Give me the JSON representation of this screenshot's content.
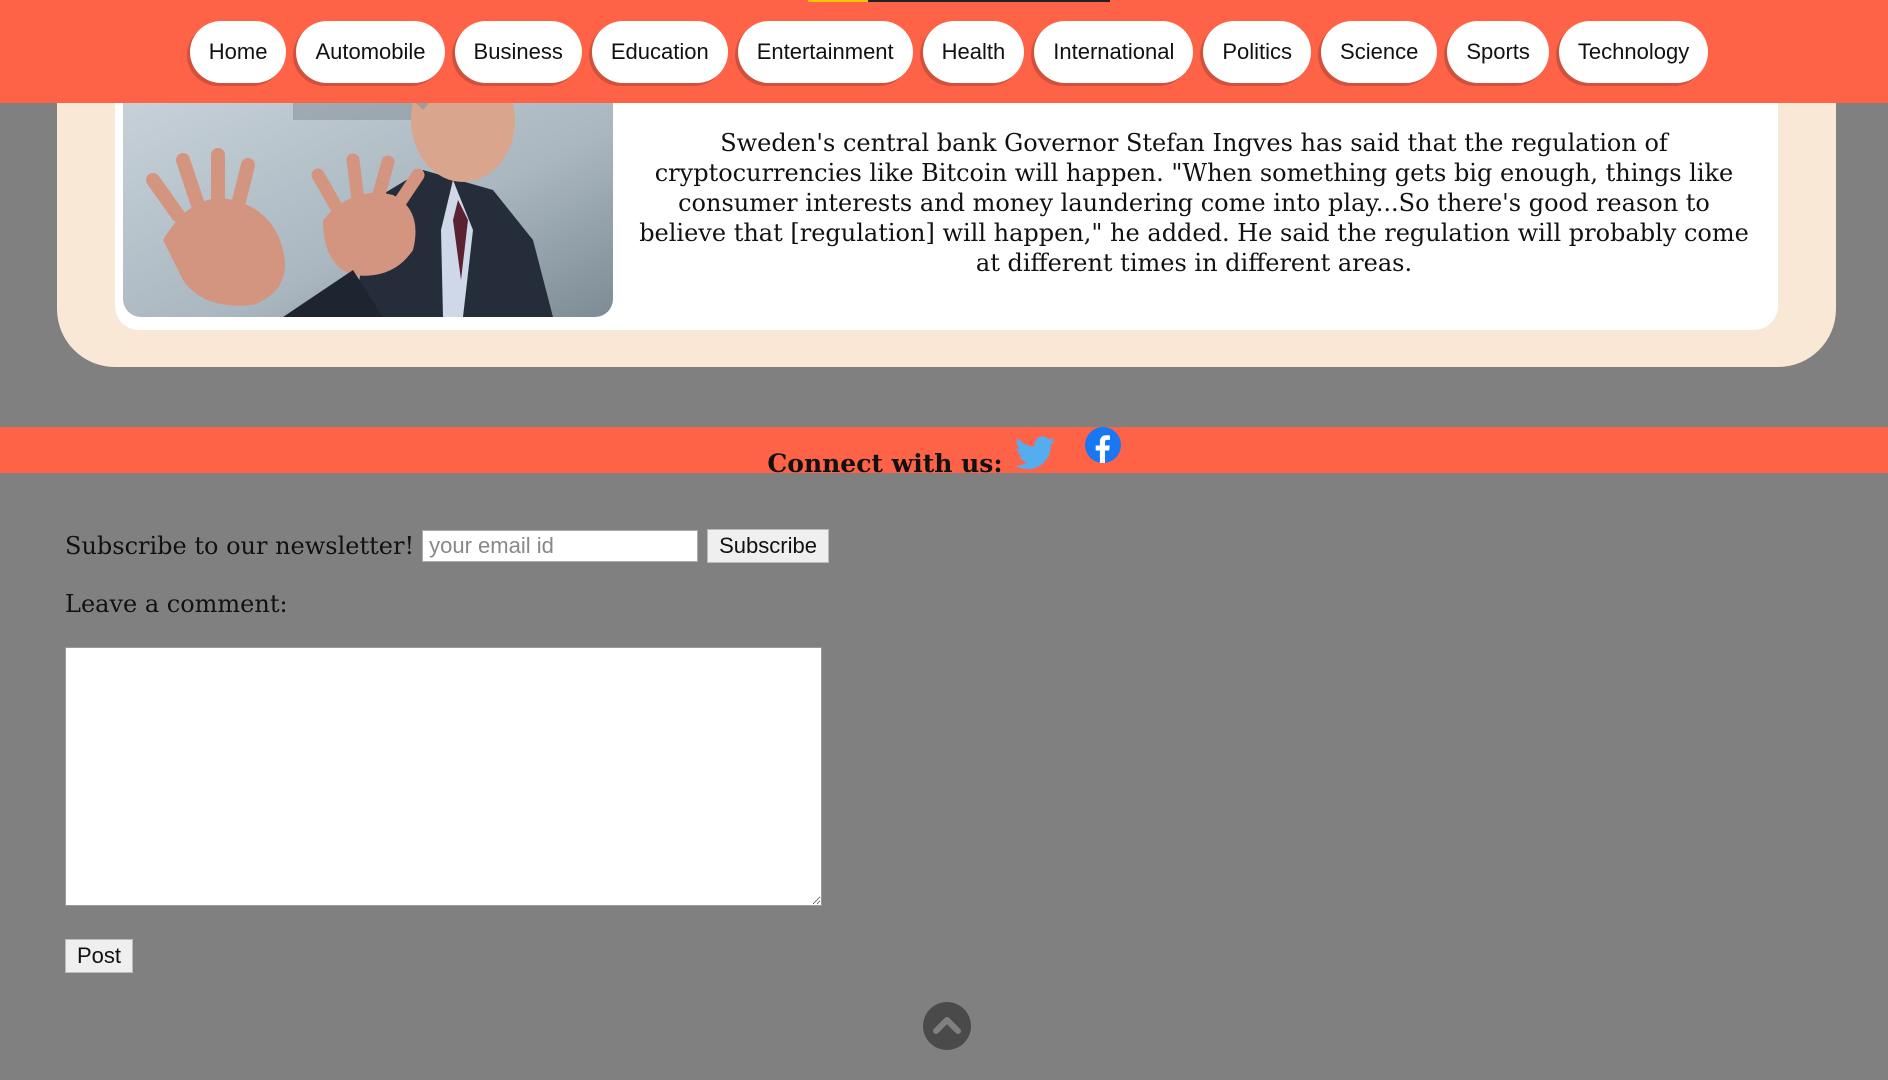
{
  "nav": {
    "items": [
      {
        "label": "Home"
      },
      {
        "label": "Automobile"
      },
      {
        "label": "Business"
      },
      {
        "label": "Education"
      },
      {
        "label": "Entertainment"
      },
      {
        "label": "Health"
      },
      {
        "label": "International"
      },
      {
        "label": "Politics"
      },
      {
        "label": "Science"
      },
      {
        "label": "Sports"
      },
      {
        "label": "Technology"
      }
    ]
  },
  "article": {
    "body": "Sweden's central bank Governor Stefan Ingves has said that the regulation of cryptocurrencies like Bitcoin will happen. \"When something gets big enough, things like consumer interests and money laundering come into play...So there's good reason to believe that [regulation] will happen,\" he added. He said the regulation will probably come at different times in different areas."
  },
  "connect": {
    "label": "Connect with us:",
    "icons": [
      "twitter-icon",
      "facebook-icon"
    ]
  },
  "newsletter": {
    "label": "Subscribe to our newsletter!",
    "email_placeholder": "your email id",
    "button_label": "Subscribe"
  },
  "comment": {
    "label": "Leave a comment:",
    "post_label": "Post"
  },
  "colors": {
    "accent": "#FF6347",
    "card": "#F9E8D6",
    "background": "#808080"
  }
}
